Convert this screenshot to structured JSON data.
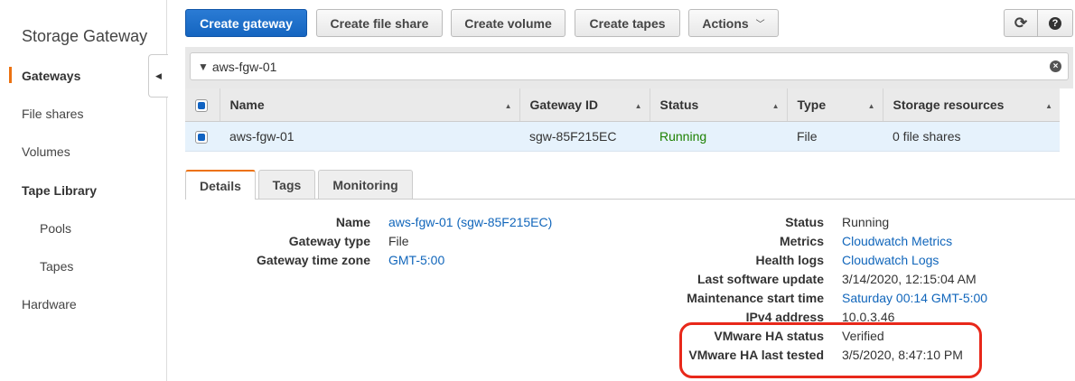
{
  "sidebar": {
    "title": "Storage Gateway",
    "items": [
      {
        "label": "Gateways"
      },
      {
        "label": "File shares"
      },
      {
        "label": "Volumes"
      },
      {
        "label": "Tape Library"
      },
      {
        "label": "Pools"
      },
      {
        "label": "Tapes"
      },
      {
        "label": "Hardware"
      }
    ]
  },
  "toolbar": {
    "create_gateway": "Create gateway",
    "create_file_share": "Create file share",
    "create_volume": "Create volume",
    "create_tapes": "Create tapes",
    "actions": "Actions"
  },
  "filter": {
    "value": "aws-fgw-01"
  },
  "table": {
    "columns": [
      "Name",
      "Gateway ID",
      "Status",
      "Type",
      "Storage resources"
    ],
    "rows": [
      {
        "name": "aws-fgw-01",
        "gateway_id": "sgw-85F215EC",
        "status": "Running",
        "type": "File",
        "storage": "0 file shares"
      }
    ]
  },
  "tabs": [
    "Details",
    "Tags",
    "Monitoring"
  ],
  "details": {
    "left": [
      {
        "label": "Name",
        "value": "aws-fgw-01 (sgw-85F215EC)"
      },
      {
        "label": "Gateway type",
        "value": "File"
      },
      {
        "label": "Gateway time zone",
        "value": "GMT-5:00"
      }
    ],
    "right": [
      {
        "label": "Status",
        "value": "Running"
      },
      {
        "label": "Metrics",
        "value": "Cloudwatch Metrics"
      },
      {
        "label": "Health logs",
        "value": "Cloudwatch Logs"
      },
      {
        "label": "Last software update",
        "value": "3/14/2020, 12:15:04 AM"
      },
      {
        "label": "Maintenance start time",
        "value": "Saturday 00:14 GMT-5:00"
      },
      {
        "label": "IPv4 address",
        "value": "10.0.3.46"
      },
      {
        "label": "VMware HA status",
        "value": "Verified"
      },
      {
        "label": "VMware HA last tested",
        "value": "3/5/2020, 8:47:10 PM"
      }
    ]
  },
  "colors": {
    "primary": "#1565c0",
    "accent": "#ec7211",
    "link": "#1166bb",
    "running": "#1d8102",
    "highlight": "#e8281a"
  }
}
